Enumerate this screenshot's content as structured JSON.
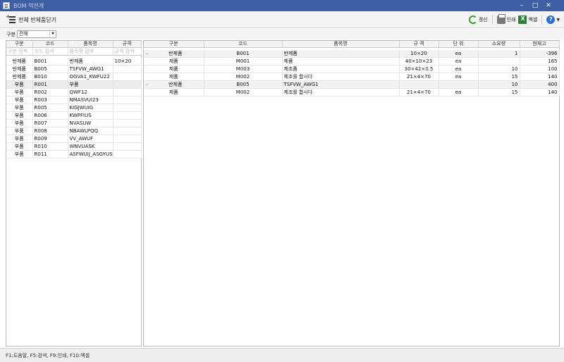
{
  "window": {
    "title": "BOM 역전개"
  },
  "toolbar": {
    "collapse_label": "전체 반제품닫기",
    "refresh_label": "갱신",
    "print_label": "인쇄",
    "excel_label": "엑셀"
  },
  "filter": {
    "label": "구분",
    "value": "전체"
  },
  "left_grid": {
    "columns": [
      "구분",
      "코드",
      "품목명",
      "규격"
    ],
    "search": [
      "구분 검색",
      "코드 검색",
      "품목명 검색",
      "규격 검색"
    ],
    "rows": [
      [
        "반제품",
        "B001",
        "반제품",
        "10×20"
      ],
      [
        "반제품",
        "B005",
        "TSFVW_AWG1",
        ""
      ],
      [
        "반제품",
        "B010",
        "OGVA1_KWFU22",
        ""
      ],
      [
        "부품",
        "R001",
        "부품",
        ""
      ],
      [
        "부품",
        "R002",
        "QWF12",
        ""
      ],
      [
        "부품",
        "R003",
        "NMASVUI23",
        ""
      ],
      [
        "부품",
        "R005",
        "KIGJWUIG",
        ""
      ],
      [
        "부품",
        "R006",
        "KWPFIUS",
        ""
      ],
      [
        "부품",
        "R007",
        "NVASUW",
        ""
      ],
      [
        "부품",
        "R008",
        "NBAWLPQQ",
        ""
      ],
      [
        "부품",
        "R009",
        "VV_AWUF",
        ""
      ],
      [
        "부품",
        "R010",
        "WNVUASK",
        ""
      ],
      [
        "부품",
        "R011",
        "ASFWUIJ_ASGYUS",
        ""
      ]
    ]
  },
  "right_grid": {
    "columns": [
      "구분",
      "코드",
      "품목명",
      "규 격",
      "단 위",
      "소요량",
      "현재고"
    ],
    "rows": [
      [
        "반제품",
        "B001",
        "반제품",
        "10×20",
        "ea",
        "1",
        "-396"
      ],
      [
        "제품",
        "M001",
        "제품",
        "40×10×23",
        "ea",
        "",
        "165"
      ],
      [
        "제품",
        "M003",
        "제조품",
        "30×42×0.5",
        "ea",
        "10",
        "100"
      ],
      [
        "제품",
        "M002",
        "제조를 합시다",
        "21×4×70",
        "ea",
        "15",
        "140"
      ],
      [
        "반제품",
        "B005",
        "TSFVW_AWG1",
        "",
        "",
        "10",
        "400"
      ],
      [
        "제품",
        "M002",
        "제조를 합시다",
        "21×4×70",
        "ea",
        "15",
        "140"
      ]
    ]
  },
  "status": {
    "text": "F1:도움말, F5:검색, F9:인쇄, F10:엑셀"
  },
  "colors": {
    "titlebar": "#3e5fa3",
    "excel": "#2c7d3a",
    "refresh": "#3c9a2f",
    "help": "#2c6ed0"
  }
}
